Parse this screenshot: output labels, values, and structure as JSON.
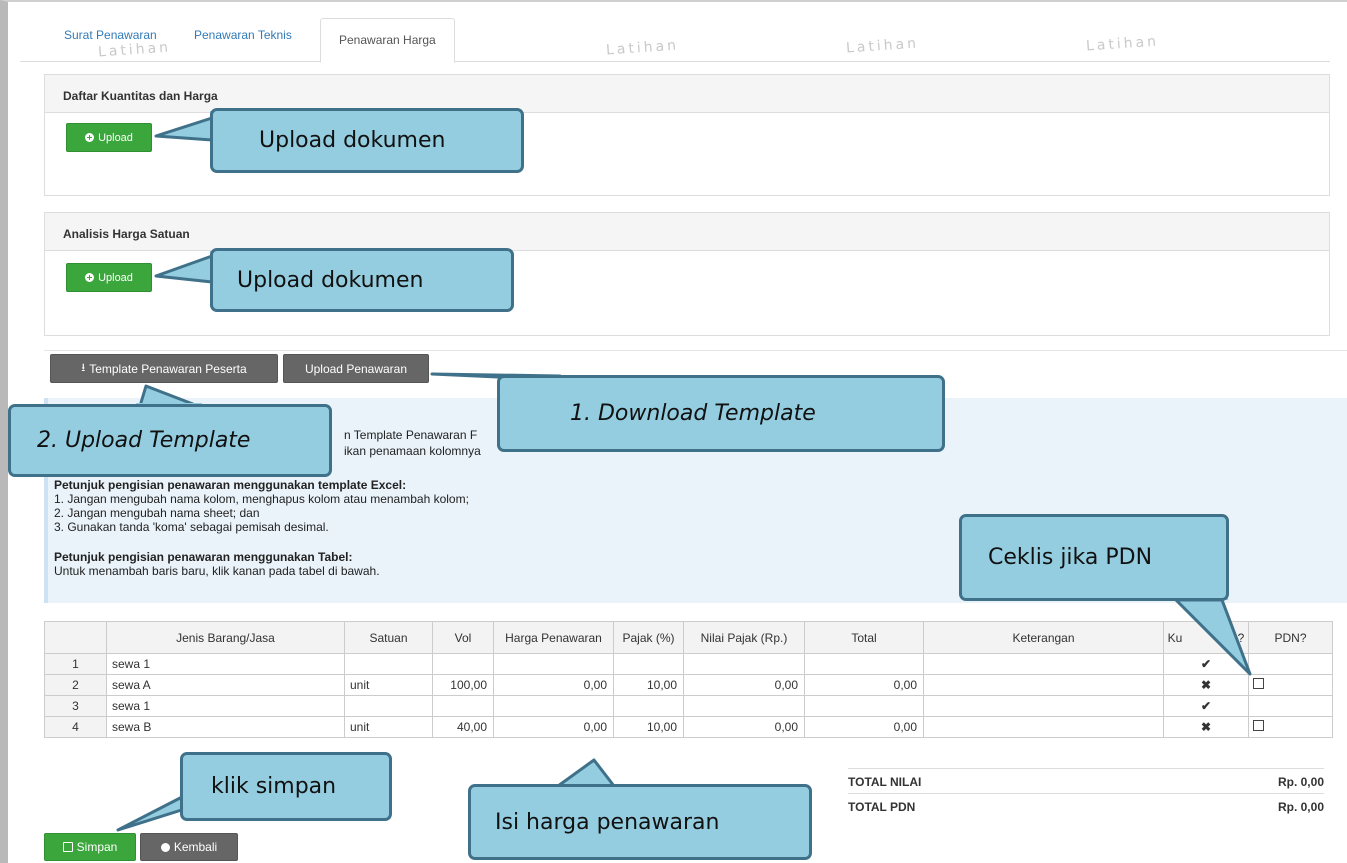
{
  "tabs": [
    {
      "label": "Surat Penawaran"
    },
    {
      "label": "Penawaran Teknis"
    },
    {
      "label": "Penawaran Harga"
    }
  ],
  "watermark": "Latihan",
  "sections": [
    {
      "title": "Daftar Kuantitas dan Harga",
      "upload_label": "Upload"
    },
    {
      "title": "Analisis Harga Satuan",
      "upload_label": "Upload"
    }
  ],
  "toolbar": {
    "template_label": "Template Penawaran Peserta",
    "upload_label": "Upload Penawaran"
  },
  "info": {
    "line1": "n Template Penawaran F",
    "line2": "ikan penamaan kolomnya",
    "excel_heading": "Petunjuk pengisian penawaran menggunakan template Excel:",
    "excel_items": [
      "1. Jangan mengubah nama kolom, menghapus kolom atau menambah kolom;",
      "2. Jangan mengubah nama sheet; dan",
      "3. Gunakan tanda 'koma' sebagai pemisah desimal."
    ],
    "table_heading": "Petunjuk pengisian penawaran menggunakan Tabel:",
    "table_text": "Untuk menambah baris baru, klik kanan pada tabel di bawah."
  },
  "table": {
    "headers": [
      "",
      "Jenis Barang/Jasa",
      "Satuan",
      "Vol",
      "Harga Penawaran",
      "Pajak (%)",
      "Nilai Pajak (Rp.)",
      "Total",
      "Keterangan",
      "Kurang Baris?",
      "PDN?"
    ],
    "header_visible_kb": "Ku",
    "header_visible_kb2": "aris?",
    "rows": [
      {
        "no": "1",
        "jenis": "sewa 1",
        "satuan": "",
        "vol": "",
        "harga": "",
        "pajak": "",
        "nilai": "",
        "total": "",
        "ket": "",
        "status": "check",
        "pdn": false
      },
      {
        "no": "2",
        "jenis": "sewa A",
        "satuan": "unit",
        "vol": "100,00",
        "harga": "0,00",
        "pajak": "10,00",
        "nilai": "0,00",
        "total": "0,00",
        "ket": "",
        "status": "cross",
        "pdn": true
      },
      {
        "no": "3",
        "jenis": "sewa 1",
        "satuan": "",
        "vol": "",
        "harga": "",
        "pajak": "",
        "nilai": "",
        "total": "",
        "ket": "",
        "status": "check",
        "pdn": false
      },
      {
        "no": "4",
        "jenis": "sewa B",
        "satuan": "unit",
        "vol": "40,00",
        "harga": "0,00",
        "pajak": "10,00",
        "nilai": "0,00",
        "total": "0,00",
        "ket": "",
        "status": "cross",
        "pdn": true
      }
    ]
  },
  "totals": [
    {
      "label": "TOTAL NILAI",
      "value": "Rp. 0,00"
    },
    {
      "label": "TOTAL PDN",
      "value": "Rp. 0,00"
    }
  ],
  "buttons": {
    "save": "Simpan",
    "back": "Kembali"
  },
  "callouts": {
    "upload1": "Upload dokumen",
    "upload2": "Upload dokumen",
    "download": "1.   Download Template",
    "upload_template": "2. Upload Template",
    "pdn": "Ceklis jika PDN",
    "save": "klik simpan",
    "price": "Isi harga penawaran"
  },
  "colors": {
    "callout_fill": "#94cde0",
    "callout_border": "#40718a",
    "green": "#3aa63c",
    "gray_button": "#666666",
    "info_bg": "#eaf3fa"
  }
}
